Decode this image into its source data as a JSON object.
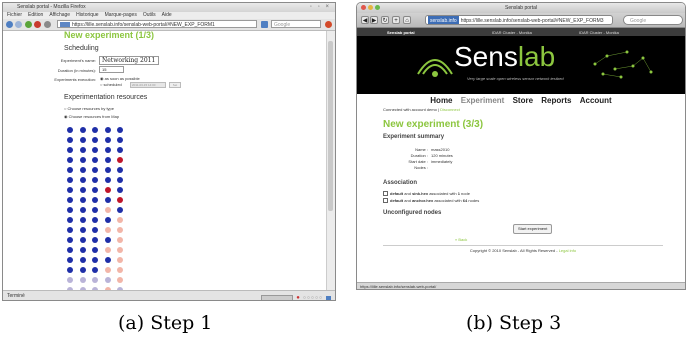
{
  "step1": {
    "window_title": "Senslab portal - Mozilla Firefox",
    "menu": [
      "Fichier",
      "Édition",
      "Affichage",
      "Historique",
      "Marque-pages",
      "Outils",
      "Aide"
    ],
    "url": "https://lille.senslab.info/senslab-web-portal/#NEW_EXP_FORM1",
    "url_host": "senslab.info",
    "search_placeholder": "Google",
    "heading": "New experiment (1/3)",
    "scheduling_title": "Scheduling",
    "exp_name_label": "Experiment's name:",
    "exp_name_value": "Networking 2011",
    "duration_label": "Duration (in minutes):",
    "duration_value": "15",
    "exec_label": "Experiments execution:",
    "exec_option_1": "as soon as possible",
    "exec_option_2": "scheduled",
    "exec_date_value": "2011-03-15 14:00",
    "exec_time_button": "Set",
    "resources_title": "Experimentation resources",
    "res_option_1": "Choose resources by type",
    "res_option_2": "Choose resources from Map",
    "status": "Terminé",
    "grid_rows": [
      [
        "blue",
        "blue",
        "blue",
        "blue",
        "blue"
      ],
      [
        "blue",
        "blue",
        "blue",
        "blue",
        "blue"
      ],
      [
        "blue",
        "blue",
        "blue",
        "blue",
        "blue"
      ],
      [
        "blue",
        "blue",
        "blue",
        "blue",
        "red"
      ],
      [
        "blue",
        "blue",
        "blue",
        "blue",
        "blue"
      ],
      [
        "blue",
        "blue",
        "blue",
        "blue",
        "blue"
      ],
      [
        "blue",
        "blue",
        "blue",
        "red",
        "blue"
      ],
      [
        "blue",
        "blue",
        "blue",
        "blue",
        "red"
      ],
      [
        "blue",
        "blue",
        "blue",
        "pink",
        "blue"
      ],
      [
        "blue",
        "blue",
        "blue",
        "blue",
        "pink"
      ],
      [
        "blue",
        "blue",
        "blue",
        "pink",
        "pink"
      ],
      [
        "blue",
        "blue",
        "blue",
        "blue",
        "pink"
      ],
      [
        "blue",
        "blue",
        "blue",
        "pink",
        "pink"
      ],
      [
        "blue",
        "blue",
        "blue",
        "blue",
        "pink"
      ],
      [
        "blue",
        "blue",
        "blue",
        "pink",
        "pink"
      ],
      [
        "lilac",
        "lilac",
        "lilac",
        "lilac",
        "pink"
      ],
      [
        "lilac",
        "lilac",
        "lilac",
        "pink",
        "lilac"
      ],
      [
        "lilac",
        "lilac",
        "lilac",
        "lilac",
        "lilac"
      ],
      [
        "lilac",
        "lilac",
        "lilac",
        "lilac",
        "lilac"
      ]
    ],
    "colors": {
      "blue": "#1f2fa8",
      "red": "#c0152a",
      "pink": "#f2b5a8",
      "lilac": "#b9b3d8",
      "brand_green": "#8cc63f"
    }
  },
  "step2": {
    "window_title": "Senslab portal",
    "url": "https://lille.senslab.info/senslab-web-portal/#NEW_EXP_FORM3",
    "url_host": "senslab.info",
    "search_placeholder": "Google",
    "tabs": [
      "Senslab portal",
      "IDAR Cluster - Monika",
      "IDAR Cluster - Monika"
    ],
    "logo_sens": "Sens",
    "logo_lab": "lab",
    "tagline": "Very large scale open wireless sensor network testbed",
    "nav": [
      "Home",
      "Experiment",
      "Store",
      "Reports",
      "Account"
    ],
    "connected": "Connected with account demo",
    "disconnect": "Disconnect",
    "heading": "New experiment (3/3)",
    "summary_title": "Experiment summary",
    "summary": [
      {
        "label": "Name :",
        "value": "mass2010"
      },
      {
        "label": "Duration :",
        "value": "120 minutes"
      },
      {
        "label": "Start date :",
        "value": "immediately"
      },
      {
        "label": "Nodes :",
        "value": ""
      }
    ],
    "association_title": "Association",
    "assoc_1_prefix": "default",
    "assoc_1_mid": "and",
    "assoc_1_file": "sink.hex",
    "assoc_1_suffix": "associated with",
    "assoc_1_count": "1",
    "assoc_1_unit": "node",
    "assoc_2_prefix": "default",
    "assoc_2_mid": "and",
    "assoc_2_file": "anchor.hex",
    "assoc_2_suffix": "associated with",
    "assoc_2_count": "64",
    "assoc_2_unit": "nodes",
    "unconfigured_title": "Unconfigured nodes",
    "start_button": "Start experiment",
    "back_link": "« Back",
    "footer": "Copyright © 2010 Senslab - All Rights Reserved -",
    "footer_link": "Legal info",
    "status": "https://lille.senslab.info/senslab-web-portal/"
  },
  "captions": {
    "a": "(a) Step 1",
    "b": "(b) Step 3"
  }
}
